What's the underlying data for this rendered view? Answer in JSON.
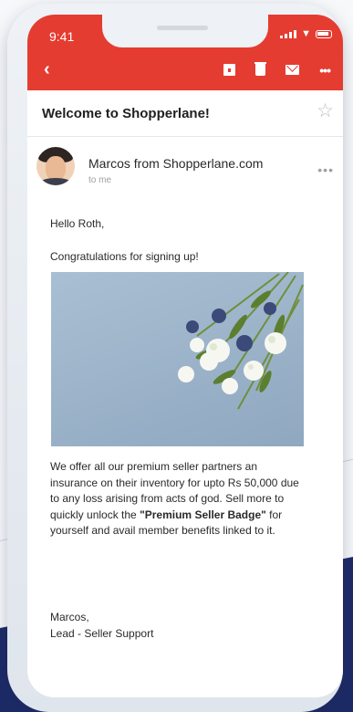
{
  "status_bar": {
    "time": "9:41"
  },
  "toolbar": {
    "back_icon": "chevron-left-icon"
  },
  "email": {
    "subject": "Welcome to Shopperlane!",
    "sender": "Marcos from Shopperlane.com",
    "recipient": "to me",
    "greeting": "Hello Roth,",
    "intro": "Congratulations for signing up!",
    "paragraph_part1": "We offer all our premium seller partners an insurance on their inventory for upto Rs 50,000 due to any loss arising from acts of god. Sell more to quickly unlock the ",
    "badge_name": "\"Premium Seller Badge\"",
    "paragraph_part2": " for yourself and avail member benefits linked to it.",
    "signature_name": "Marcos,",
    "signature_title": "Lead - Seller Support"
  },
  "colors": {
    "header_red": "#e53c31",
    "background_navy": "#1c2a66",
    "photo_blue": "#9cb3c9"
  }
}
